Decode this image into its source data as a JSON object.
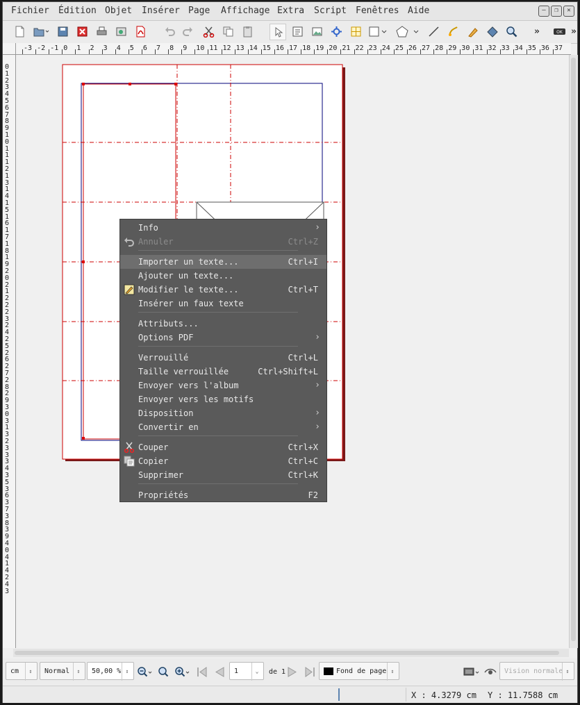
{
  "menubar": {
    "items": [
      "Fichier",
      "Édition",
      "Objet",
      "Insérer",
      "Page",
      "Affichage",
      "Extra",
      "Script",
      "Fenêtres",
      "Aide"
    ]
  },
  "toolbar": {
    "icons": [
      "new-document-icon",
      "open-icon",
      "save-icon",
      "close-icon",
      "print-icon",
      "preflight-icon",
      "export-pdf-icon",
      "undo-icon",
      "redo-icon",
      "cut-icon",
      "copy-icon",
      "paste-icon",
      "select-icon",
      "text-frame-icon",
      "image-frame-icon",
      "render-frame-icon",
      "table-icon",
      "shape-icon",
      "polygon-icon",
      "line-icon",
      "bezier-icon",
      "freehand-icon",
      "rotate-icon",
      "zoom-icon"
    ]
  },
  "rulers": {
    "h_ticks": [
      "-3",
      "-2",
      "-1",
      "0",
      "1",
      "2",
      "3",
      "4",
      "5",
      "6",
      "7",
      "8",
      "9",
      "10",
      "11",
      "12",
      "13",
      "14",
      "15",
      "16",
      "17",
      "18",
      "19",
      "20",
      "21",
      "22",
      "23",
      "24",
      "25",
      "26",
      "27",
      "28",
      "29",
      "30",
      "31",
      "32",
      "33",
      "34",
      "35",
      "36",
      "37"
    ],
    "v_ticks": [
      "0",
      "1",
      "2",
      "3",
      "4",
      "5",
      "6",
      "7",
      "8",
      "9",
      "1",
      "0",
      "1",
      "1",
      "1",
      "2",
      "1",
      "3",
      "1",
      "4",
      "1",
      "5",
      "1",
      "6",
      "1",
      "7",
      "1",
      "8",
      "1",
      "9",
      "2",
      "0",
      "2",
      "1",
      "2",
      "2",
      "2",
      "3",
      "2",
      "4",
      "2",
      "5",
      "2",
      "6",
      "2",
      "7",
      "2",
      "8",
      "2",
      "9",
      "3",
      "0",
      "3",
      "1",
      "3",
      "2",
      "3",
      "3",
      "3",
      "4",
      "3",
      "5",
      "3",
      "6",
      "3",
      "7",
      "3",
      "8",
      "3",
      "9",
      "4",
      "0",
      "4",
      "1",
      "4",
      "2",
      "4",
      "3"
    ]
  },
  "context_menu": {
    "items": [
      {
        "label": "Info",
        "shortcut": "",
        "submenu": true,
        "disabled": false,
        "highlight": false,
        "icon": ""
      },
      {
        "label": "Annuler",
        "shortcut": "Ctrl+Z",
        "submenu": false,
        "disabled": true,
        "highlight": false,
        "icon": "undo-icon"
      },
      {
        "label": "Importer un texte...",
        "shortcut": "Ctrl+I",
        "submenu": false,
        "disabled": false,
        "highlight": true,
        "icon": ""
      },
      {
        "label": "Ajouter un texte...",
        "shortcut": "",
        "submenu": false,
        "disabled": false,
        "highlight": false,
        "icon": ""
      },
      {
        "label": "Modifier le texte...",
        "shortcut": "Ctrl+T",
        "submenu": false,
        "disabled": false,
        "highlight": false,
        "icon": "edit-text-icon"
      },
      {
        "label": "Insérer un faux texte",
        "shortcut": "",
        "submenu": false,
        "disabled": false,
        "highlight": false,
        "icon": ""
      },
      {
        "label": "Attributs...",
        "shortcut": "",
        "submenu": false,
        "disabled": false,
        "highlight": false,
        "icon": ""
      },
      {
        "label": "Options PDF",
        "shortcut": "",
        "submenu": true,
        "disabled": false,
        "highlight": false,
        "icon": ""
      },
      {
        "label": "Verrouillé",
        "shortcut": "Ctrl+L",
        "submenu": false,
        "disabled": false,
        "highlight": false,
        "icon": ""
      },
      {
        "label": "Taille verrouillée",
        "shortcut": "Ctrl+Shift+L",
        "submenu": false,
        "disabled": false,
        "highlight": false,
        "icon": ""
      },
      {
        "label": "Envoyer vers l'album",
        "shortcut": "",
        "submenu": true,
        "disabled": false,
        "highlight": false,
        "icon": ""
      },
      {
        "label": "Envoyer vers les motifs",
        "shortcut": "",
        "submenu": false,
        "disabled": false,
        "highlight": false,
        "icon": ""
      },
      {
        "label": "Disposition",
        "shortcut": "",
        "submenu": true,
        "disabled": false,
        "highlight": false,
        "icon": ""
      },
      {
        "label": "Convertir en",
        "shortcut": "",
        "submenu": true,
        "disabled": false,
        "highlight": false,
        "icon": ""
      },
      {
        "label": "Couper",
        "shortcut": "Ctrl+X",
        "submenu": false,
        "disabled": false,
        "highlight": false,
        "icon": "cut-icon"
      },
      {
        "label": "Copier",
        "shortcut": "Ctrl+C",
        "submenu": false,
        "disabled": false,
        "highlight": false,
        "icon": "copy-icon"
      },
      {
        "label": "Supprimer",
        "shortcut": "Ctrl+K",
        "submenu": false,
        "disabled": false,
        "highlight": false,
        "icon": ""
      },
      {
        "label": "Propriétés",
        "shortcut": "F2",
        "submenu": false,
        "disabled": false,
        "highlight": false,
        "icon": ""
      }
    ]
  },
  "bottombar": {
    "unit": "cm",
    "image_quality": "Normal",
    "zoom": "50,00 %",
    "page_number": "1",
    "page_of": "de 1",
    "layer": "Fond de page",
    "view_mode": "Vision normale"
  },
  "status": {
    "x": "X : 4.3279 cm",
    "y": "Y : 11.7588 cm"
  },
  "colors": {
    "menu_bg": "#5a5a5a",
    "menu_highlight": "#6e6e6e",
    "guide_red": "#cc0000",
    "frame_blue": "#00007a"
  }
}
